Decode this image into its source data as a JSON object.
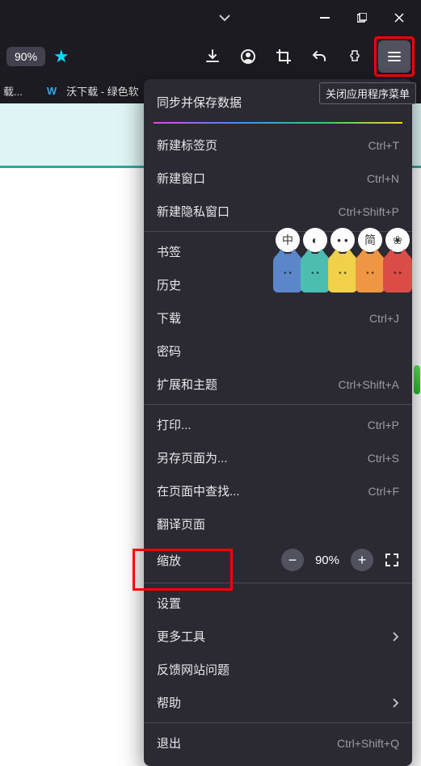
{
  "window": {
    "zoom_pill": "90%"
  },
  "bookmarks": {
    "item1": "载...",
    "item2": "沃下载 - 绿色软"
  },
  "tooltip": "关闭应用程序菜单",
  "menu": {
    "sync": "同步并保存数据",
    "new_tab": {
      "label": "新建标签页",
      "sc": "Ctrl+T"
    },
    "new_window": {
      "label": "新建窗口",
      "sc": "Ctrl+N"
    },
    "new_private": {
      "label": "新建隐私窗口",
      "sc": "Ctrl+Shift+P"
    },
    "bookmarks": "书签",
    "history": "历史",
    "downloads": {
      "label": "下载",
      "sc": "Ctrl+J"
    },
    "passwords": "密码",
    "addons": {
      "label": "扩展和主题",
      "sc": "Ctrl+Shift+A"
    },
    "print": {
      "label": "打印...",
      "sc": "Ctrl+P"
    },
    "save_as": {
      "label": "另存页面为...",
      "sc": "Ctrl+S"
    },
    "find": {
      "label": "在页面中查找...",
      "sc": "Ctrl+F"
    },
    "translate": "翻译页面",
    "zoom": {
      "label": "缩放",
      "value": "90%"
    },
    "settings": "设置",
    "more_tools": "更多工具",
    "report": "反馈网站问题",
    "help": "帮助",
    "quit": {
      "label": "退出",
      "sc": "Ctrl+Shift+Q"
    }
  },
  "cats": {
    "b1": "中",
    "b2": "●",
    "b3": "• •",
    "b4": "简",
    "b5": "✿"
  }
}
